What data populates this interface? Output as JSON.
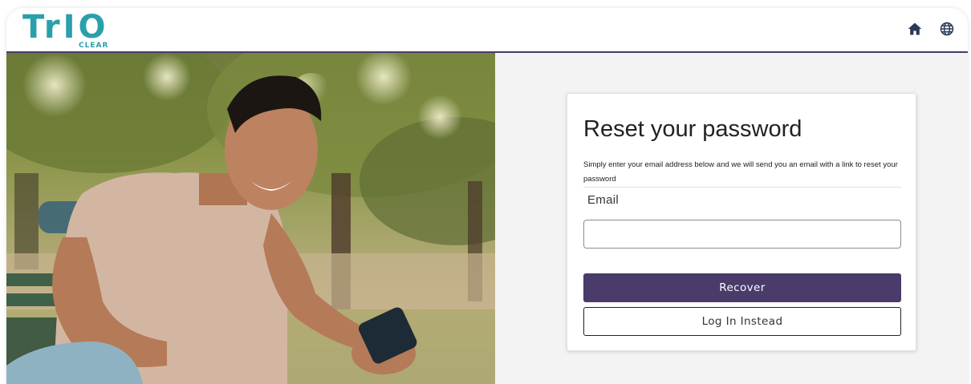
{
  "header": {
    "logo_word": "TrIO",
    "logo_sub": "CLEAR",
    "icons": [
      "home-icon",
      "globe-icon"
    ]
  },
  "colors": {
    "brand_teal": "#2aa0ab",
    "accent_purple": "#4a3b6b"
  },
  "card": {
    "title": "Reset your password",
    "description": "Simply enter your email address below and we will send you an email with a link to reset your password",
    "email_label": "Email",
    "email_value": "",
    "recover_label": "Recover",
    "login_label": "Log In Instead"
  }
}
